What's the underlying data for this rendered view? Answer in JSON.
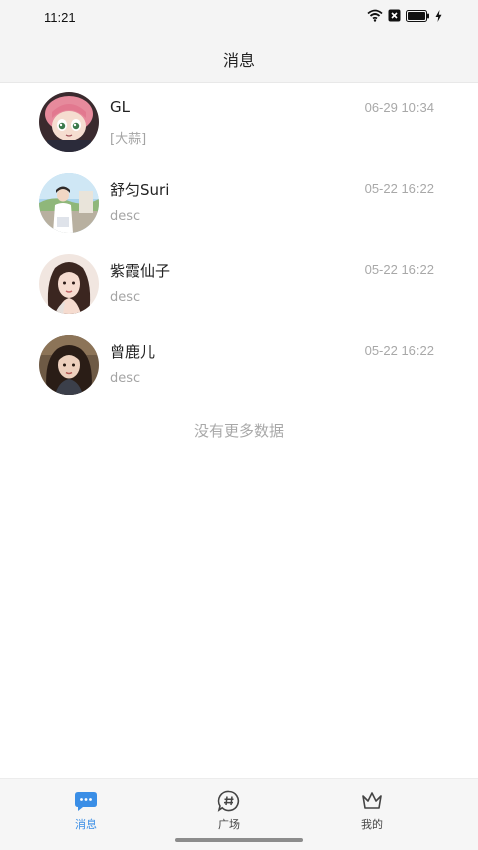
{
  "status_bar": {
    "time": "11:21",
    "icons": [
      "wifi-icon",
      "sim-off-icon",
      "battery-icon",
      "charging-bolt-icon"
    ]
  },
  "header": {
    "title": "消息"
  },
  "conversations": [
    {
      "name": "GL",
      "desc": "[大蒜]",
      "time": "06-29 10:34",
      "avatar": "anime-girl-avatar"
    },
    {
      "name": "舒匀Suri",
      "desc": "desc",
      "time": "05-22 16:22",
      "avatar": "outdoor-photo-avatar"
    },
    {
      "name": "紫霞仙子",
      "desc": "desc",
      "time": "05-22 16:22",
      "avatar": "portrait-avatar"
    },
    {
      "name": "曾鹿儿",
      "desc": "desc",
      "time": "05-22 16:22",
      "avatar": "portrait-avatar"
    }
  ],
  "list_footer": "没有更多数据",
  "tab_bar": {
    "tabs": [
      {
        "label": "消息",
        "icon": "chat-bubble-icon",
        "active": true
      },
      {
        "label": "广场",
        "icon": "hashtag-bubble-icon",
        "active": false
      },
      {
        "label": "我的",
        "icon": "crown-icon",
        "active": false
      }
    ],
    "active_color": "#3a8ee6"
  }
}
